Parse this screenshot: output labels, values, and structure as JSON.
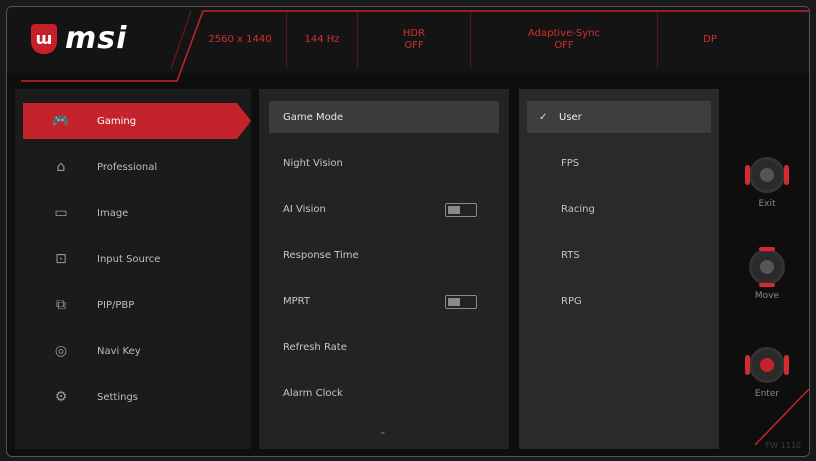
{
  "brand": {
    "name": "msi",
    "shield_glyph": "ɯ"
  },
  "header": {
    "cells": [
      {
        "lines": [
          "2560 x 1440"
        ]
      },
      {
        "lines": [
          "144 Hz"
        ]
      },
      {
        "lines": [
          "HDR",
          "OFF"
        ]
      },
      {
        "lines": [
          "Adaptive-Sync",
          "OFF"
        ]
      },
      {
        "lines": [
          "DP"
        ]
      }
    ]
  },
  "sidebar": {
    "items": [
      {
        "label": "Gaming",
        "icon": "gamepad-icon",
        "glyph": "🎮",
        "active": true
      },
      {
        "label": "Professional",
        "icon": "house-icon",
        "glyph": "⌂",
        "active": false
      },
      {
        "label": "Image",
        "icon": "image-icon",
        "glyph": "▭",
        "active": false
      },
      {
        "label": "Input Source",
        "icon": "input-source-icon",
        "glyph": "⊡",
        "active": false
      },
      {
        "label": "PIP/PBP",
        "icon": "pip-icon",
        "glyph": "⧉",
        "active": false
      },
      {
        "label": "Navi Key",
        "icon": "navi-key-icon",
        "glyph": "◎",
        "active": false
      },
      {
        "label": "Settings",
        "icon": "settings-icon",
        "glyph": "⚙",
        "active": false
      }
    ]
  },
  "middle": {
    "items": [
      {
        "label": "Game Mode",
        "selected": true,
        "toggle": false
      },
      {
        "label": "Night Vision",
        "selected": false,
        "toggle": false
      },
      {
        "label": "AI Vision",
        "selected": false,
        "toggle": true
      },
      {
        "label": "Response Time",
        "selected": false,
        "toggle": false
      },
      {
        "label": "MPRT",
        "selected": false,
        "toggle": true
      },
      {
        "label": "Refresh Rate",
        "selected": false,
        "toggle": false
      },
      {
        "label": "Alarm Clock",
        "selected": false,
        "toggle": false
      }
    ],
    "more_glyph": "⌄"
  },
  "options": {
    "items": [
      {
        "label": "User",
        "selected": true
      },
      {
        "label": "FPS",
        "selected": false
      },
      {
        "label": "Racing",
        "selected": false
      },
      {
        "label": "RTS",
        "selected": false
      },
      {
        "label": "RPG",
        "selected": false
      }
    ],
    "check_glyph": "✓"
  },
  "nav": {
    "buttons": [
      {
        "label": "Exit"
      },
      {
        "label": "Move"
      },
      {
        "label": "Enter"
      }
    ],
    "version": "FW 1110"
  },
  "colors": {
    "accent": "#c4232b",
    "header_text": "#d03030",
    "background": "#0e0e0e"
  }
}
